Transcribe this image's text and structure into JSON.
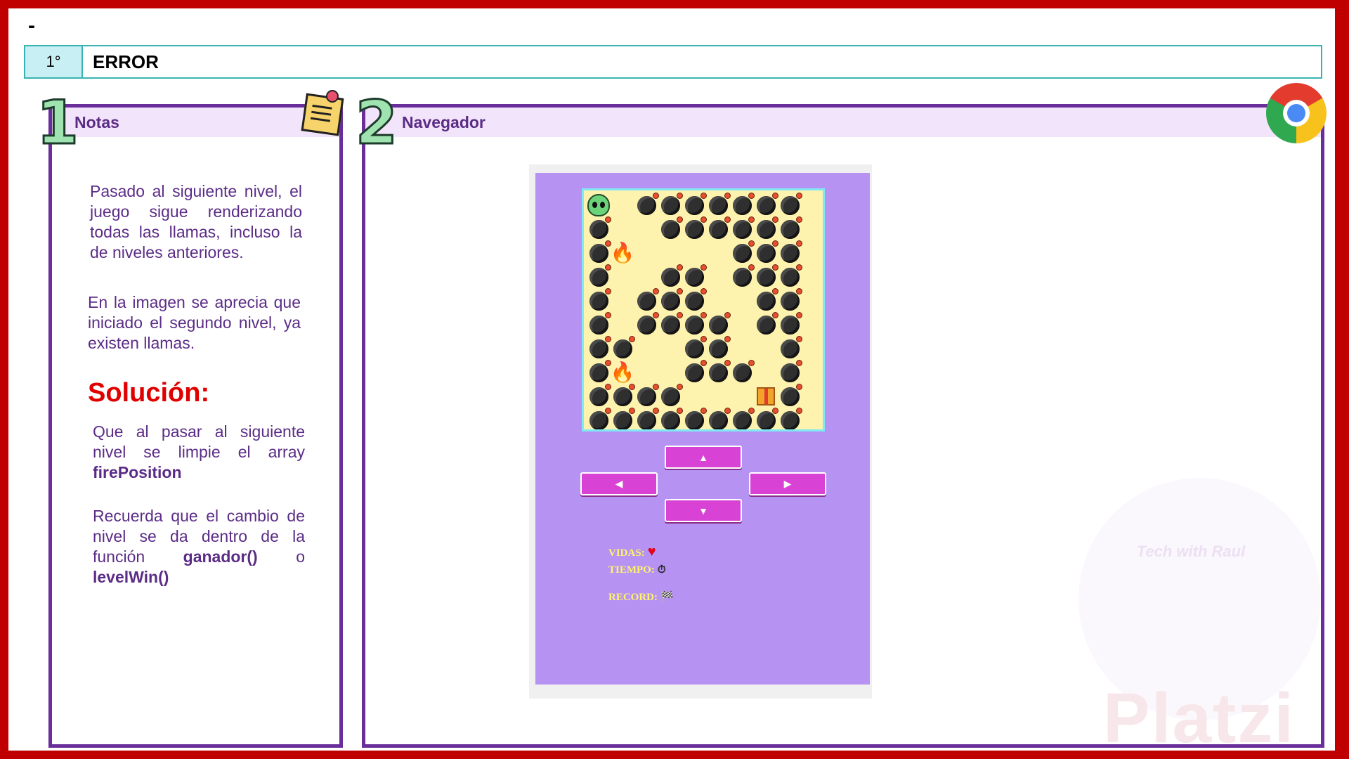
{
  "header": {
    "dash": "-",
    "number": "1°",
    "title": "ERROR"
  },
  "notes_panel": {
    "badge": "1",
    "title": "Notas",
    "paragraph1": "Pasado al siguiente nivel, el juego sigue renderizando todas las llamas, incluso la de niveles anteriores.",
    "paragraph2": "En la imagen se aprecia que iniciado el segundo nivel, ya existen llamas.",
    "solution_title": "Solución:",
    "solution_text": "Que al pasar al siguiente nivel se limpie el array",
    "solution_keyword": "firePosition",
    "reminder_text": "Recuerda que el cambio de nivel se da dentro de la función",
    "reminder_kw1": "ganador()",
    "reminder_or": "o",
    "reminder_kw2": "levelWin()"
  },
  "browser_panel": {
    "badge": "2",
    "title": "Navegador"
  },
  "game": {
    "grid": [
      "P.XXXXXXX",
      "X..XXXXXX",
      "XF....XXX",
      "X..XX.XXX",
      "X.XXX..XX",
      "X.XXXX.XX",
      "XX..XX..X",
      "XF..XXX.X",
      "XXXX...GX",
      "XXXXXXXXX"
    ],
    "legend": {
      "P": "player",
      "X": "bomb",
      "F": "fire",
      "G": "gift",
      ".": "empty"
    },
    "controls": {
      "up": "▲",
      "left": "◀",
      "right": "▶",
      "down": "▼"
    },
    "stats": {
      "lives_label": "VIDAS:",
      "lives_value": "♥",
      "time_label": "TIEMPO:",
      "time_value": "⏱",
      "record_label": "RECORD:",
      "record_value": "🏁"
    }
  },
  "watermark": {
    "text": "Tech with Raul",
    "brand": "Platzi"
  },
  "colors": {
    "frame": "#c00000",
    "panel_border": "#6a2e9a",
    "panel_header": "#f2e4fb",
    "game_bg": "#b692f2",
    "board_bg": "#fdf2ae",
    "button": "#d843d5"
  }
}
